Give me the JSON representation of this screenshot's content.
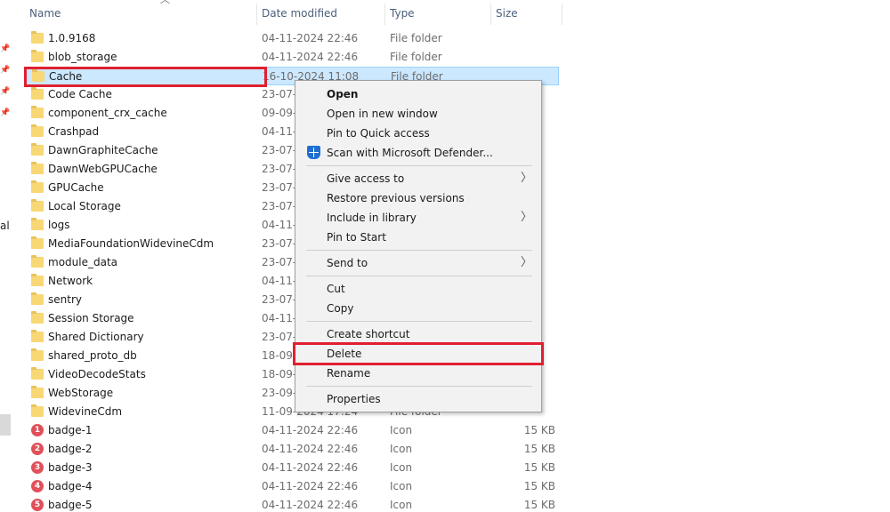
{
  "columns": {
    "name": "Name",
    "date": "Date modified",
    "type": "Type",
    "size": "Size"
  },
  "nav_fragment": "al",
  "rows": [
    {
      "name": "1.0.9168",
      "date": "04-11-2024 22:46",
      "type": "File folder",
      "size": "",
      "icon": "folder-icon"
    },
    {
      "name": "blob_storage",
      "date": "04-11-2024 22:46",
      "type": "File folder",
      "size": "",
      "icon": "folder-icon"
    },
    {
      "name": "Cache",
      "date": "16-10-2024 11:08",
      "type": "File folder",
      "size": "",
      "icon": "folder-icon",
      "selected": true
    },
    {
      "name": "Code Cache",
      "date": "23-07-",
      "type": "",
      "size": "",
      "icon": "folder-icon"
    },
    {
      "name": "component_crx_cache",
      "date": "09-09-",
      "type": "",
      "size": "",
      "icon": "folder-icon"
    },
    {
      "name": "Crashpad",
      "date": "04-11-",
      "type": "",
      "size": "",
      "icon": "folder-icon"
    },
    {
      "name": "DawnGraphiteCache",
      "date": "23-07-",
      "type": "",
      "size": "",
      "icon": "folder-icon"
    },
    {
      "name": "DawnWebGPUCache",
      "date": "23-07-",
      "type": "",
      "size": "",
      "icon": "folder-icon"
    },
    {
      "name": "GPUCache",
      "date": "23-07-",
      "type": "",
      "size": "",
      "icon": "folder-icon"
    },
    {
      "name": "Local Storage",
      "date": "23-07-",
      "type": "",
      "size": "",
      "icon": "folder-icon"
    },
    {
      "name": "logs",
      "date": "04-11-",
      "type": "",
      "size": "",
      "icon": "folder-icon"
    },
    {
      "name": "MediaFoundationWidevineCdm",
      "date": "23-07-",
      "type": "",
      "size": "",
      "icon": "folder-icon"
    },
    {
      "name": "module_data",
      "date": "23-07-",
      "type": "",
      "size": "",
      "icon": "folder-icon"
    },
    {
      "name": "Network",
      "date": "04-11-",
      "type": "",
      "size": "",
      "icon": "folder-icon"
    },
    {
      "name": "sentry",
      "date": "23-07-",
      "type": "",
      "size": "",
      "icon": "folder-icon"
    },
    {
      "name": "Session Storage",
      "date": "04-11-",
      "type": "",
      "size": "",
      "icon": "folder-icon"
    },
    {
      "name": "Shared Dictionary",
      "date": "23-07-",
      "type": "",
      "size": "",
      "icon": "folder-icon"
    },
    {
      "name": "shared_proto_db",
      "date": "18-09-",
      "type": "",
      "size": "",
      "icon": "folder-icon"
    },
    {
      "name": "VideoDecodeStats",
      "date": "18-09-",
      "type": "",
      "size": "",
      "icon": "folder-icon"
    },
    {
      "name": "WebStorage",
      "date": "23-09-",
      "type": "",
      "size": "",
      "icon": "folder-icon"
    },
    {
      "name": "WidevineCdm",
      "date": "11-09-2024 17:24",
      "type": "File folder",
      "size": "",
      "icon": "folder-icon"
    },
    {
      "name": "badge-1",
      "date": "04-11-2024 22:46",
      "type": "Icon",
      "size": "15 KB",
      "icon": "badge-icon",
      "badge_num": "1"
    },
    {
      "name": "badge-2",
      "date": "04-11-2024 22:46",
      "type": "Icon",
      "size": "15 KB",
      "icon": "badge-icon",
      "badge_num": "2"
    },
    {
      "name": "badge-3",
      "date": "04-11-2024 22:46",
      "type": "Icon",
      "size": "15 KB",
      "icon": "badge-icon",
      "badge_num": "3"
    },
    {
      "name": "badge-4",
      "date": "04-11-2024 22:46",
      "type": "Icon",
      "size": "15 KB",
      "icon": "badge-icon",
      "badge_num": "4"
    },
    {
      "name": "badge-5",
      "date": "04-11-2024 22:46",
      "type": "Icon",
      "size": "15 KB",
      "icon": "badge-icon",
      "badge_num": "5"
    }
  ],
  "context_menu": {
    "open": "Open",
    "open_new_window": "Open in new window",
    "pin_quick_access": "Pin to Quick access",
    "scan_defender": "Scan with Microsoft Defender...",
    "give_access": "Give access to",
    "restore_versions": "Restore previous versions",
    "include_library": "Include in library",
    "pin_start": "Pin to Start",
    "send_to": "Send to",
    "cut": "Cut",
    "copy": "Copy",
    "create_shortcut": "Create shortcut",
    "delete": "Delete",
    "rename": "Rename",
    "properties": "Properties"
  },
  "colors": {
    "highlight_red": "#e02030",
    "selection_blue": "#cce8ff",
    "folder_yellow": "#f8d775",
    "badge_red": "#e0505a",
    "defender_blue": "#1f6fd1"
  }
}
